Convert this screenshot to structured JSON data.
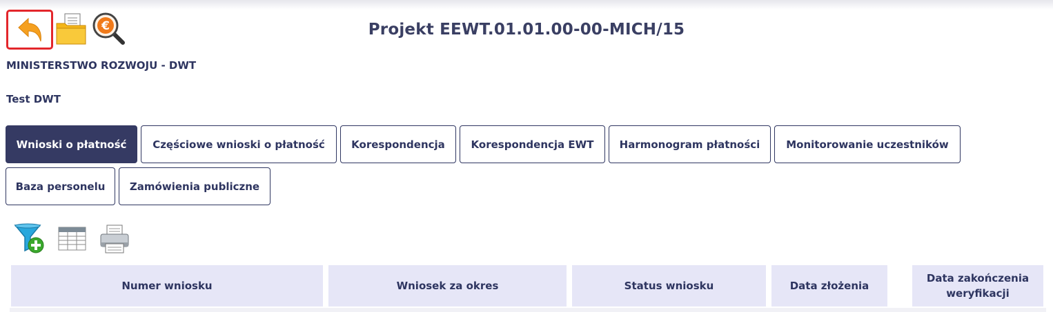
{
  "header": {
    "title": "Projekt EEWT.01.01.00-00-MICH/15",
    "institution": "MINISTERSTWO ROZWOJU - DWT",
    "project_name": "Test DWT"
  },
  "toolbar": {
    "back_icon": "back-arrow-icon",
    "folder_icon": "folder-documents-icon",
    "euro_icon": "euro-search-icon",
    "highlight_color": "#e3262b"
  },
  "tabs": [
    {
      "label": "Wnioski o płatność",
      "active": true
    },
    {
      "label": "Częściowe wnioski o płatność",
      "active": false
    },
    {
      "label": "Korespondencja",
      "active": false
    },
    {
      "label": "Korespondencja EWT",
      "active": false
    },
    {
      "label": "Harmonogram płatności",
      "active": false
    },
    {
      "label": "Monitorowanie uczestników",
      "active": false
    },
    {
      "label": "Baza personelu",
      "active": false
    },
    {
      "label": "Zamówienia publiczne",
      "active": false
    }
  ],
  "tools": {
    "filter_icon": "filter-add-icon",
    "table_icon": "table-columns-icon",
    "print_icon": "printer-icon"
  },
  "table": {
    "columns": [
      "Numer wniosku",
      "Wniosek za okres",
      "Status wniosku",
      "Data złożenia",
      "Data zakończenia weryfikacji"
    ]
  },
  "colors": {
    "active_tab_bg": "#353a63",
    "header_bg": "#e6e6f7",
    "text": "#2e3560"
  }
}
